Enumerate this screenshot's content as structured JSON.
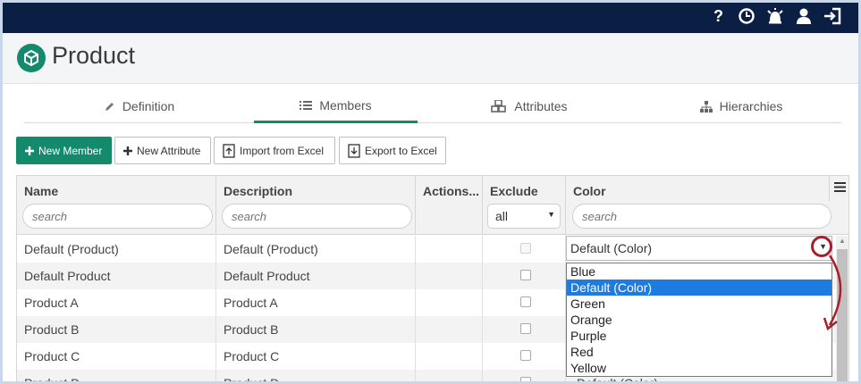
{
  "topbar": {
    "icons": [
      "help-icon",
      "clock-icon",
      "alarm-icon",
      "user-icon",
      "logout-icon"
    ]
  },
  "header": {
    "title": "Product",
    "logo_icon": "product-cube-icon"
  },
  "tabs": [
    {
      "label": "Definition",
      "icon": "pencil-icon"
    },
    {
      "label": "Members",
      "icon": "list-icon",
      "active": true
    },
    {
      "label": "Attributes",
      "icon": "cubes-icon"
    },
    {
      "label": "Hierarchies",
      "icon": "sitemap-icon"
    }
  ],
  "toolbar": {
    "new_member": "New Member",
    "new_attribute": "New Attribute",
    "import_excel": "Import from Excel",
    "export_excel": "Export to Excel"
  },
  "grid": {
    "columns": {
      "name": "Name",
      "description": "Description",
      "actions": "Actions...",
      "exclude": "Exclude",
      "color": "Color"
    },
    "filters": {
      "name_placeholder": "search",
      "description_placeholder": "search",
      "exclude_value": "all",
      "color_placeholder": "search"
    },
    "rows": [
      {
        "name": "Default (Product)",
        "description": "Default (Product)",
        "color": "Default (Color)"
      },
      {
        "name": "Default Product",
        "description": "Default Product"
      },
      {
        "name": "Product A",
        "description": "Product A"
      },
      {
        "name": "Product B",
        "description": "Product B"
      },
      {
        "name": "Product C",
        "description": "Product C"
      },
      {
        "name": "Product D",
        "description": "Product D",
        "color": "Default (Color)"
      }
    ]
  },
  "color_dropdown": {
    "current": "Default (Color)",
    "options": [
      "Blue",
      "Default (Color)",
      "Green",
      "Orange",
      "Purple",
      "Red",
      "Yellow"
    ],
    "selected_index": 1
  },
  "colors": {
    "topbar": "#0b1f45",
    "accent": "#138a6c",
    "selection": "#1e7be0",
    "annotation": "#a81e2a"
  }
}
